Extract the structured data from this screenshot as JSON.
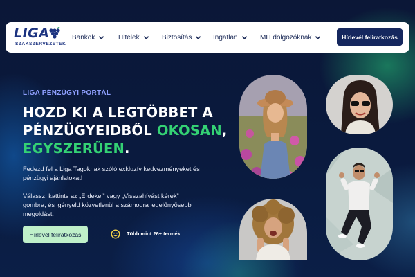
{
  "header": {
    "logo": {
      "word": "LIGA",
      "sub": "SZAKSZERVEZETEK"
    },
    "nav": [
      {
        "label": "Bankok"
      },
      {
        "label": "Hitelek"
      },
      {
        "label": "Biztosítás"
      },
      {
        "label": "Ingatlan"
      },
      {
        "label": "MH dolgozóknak"
      }
    ],
    "cta_label": "Hírlevél feliratkozás"
  },
  "hero": {
    "eyebrow": "LIGA PÉNZÜGYI PORTÁL",
    "headline_line1": "HOZD KI A LEGTÖBBET A",
    "headline_line2_white": "PÉNZÜGYEIDBŐL ",
    "headline_line2_green": "OKOSAN",
    "headline_line2_comma": ",",
    "headline_line3_green": "EGYSZERŰEN",
    "headline_line3_period": ".",
    "para1": "Fedezd fel a Liga Tagoknak szóló exkluzív kedvezményeket és pénzügyi ajánlatokat!",
    "para2": "Válassz, kattints az „Érdekel” vagy „Visszahívást kérek” gombra, és igényeld közvetlenül a számodra legelőnyösebb megoldást.",
    "cta_label": "Hírlevél feliratkozás",
    "products_text": "Több mint 26+ termék"
  },
  "colors": {
    "background": "#0a1838",
    "accent_green": "#34d274",
    "eyebrow": "#8fa0ff",
    "navy_button": "#15275e",
    "mint_button": "#bff0c9"
  },
  "icons": [
    "grapes-logo-icon",
    "chevron-down-icon",
    "smiley-icon"
  ]
}
